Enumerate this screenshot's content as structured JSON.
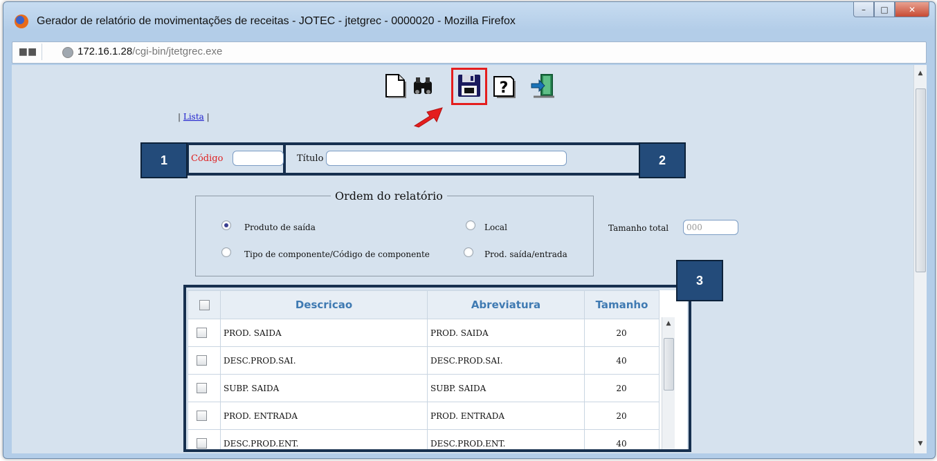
{
  "window": {
    "title": "Gerador de relatório de movimentações de receitas - JOTEC - jtetgrec - 0000020 - Mozilla Firefox",
    "url_host": "172.16.1.28",
    "url_path": "/cgi-bin/jtetgrec.exe"
  },
  "toolbar": {
    "icons": [
      "new-document-icon",
      "binoculars-search-icon",
      "floppy-save-icon",
      "help-icon",
      "exit-door-icon"
    ],
    "highlighted": "floppy-save-icon"
  },
  "nav": {
    "sep_left": "|",
    "lista": "Lista",
    "sep_right": "|"
  },
  "form": {
    "codigo_label": "Código",
    "codigo_value": "",
    "titulo_label": "Título",
    "titulo_value": "",
    "tamanho_label": "Tamanho total",
    "tamanho_placeholder": "000"
  },
  "ordem": {
    "legend": "Ordem do relatório",
    "options": [
      {
        "label": "Produto de saída",
        "selected": true
      },
      {
        "label": "Local",
        "selected": false
      },
      {
        "label": "Tipo de componente/Código de componente",
        "selected": false
      },
      {
        "label": "Prod. saída/entrada",
        "selected": false
      }
    ]
  },
  "grid": {
    "headers": [
      "Descricao",
      "Abreviatura",
      "Tamanho"
    ],
    "rows": [
      {
        "descricao": "PROD. SAIDA",
        "abreviatura": "PROD. SAIDA",
        "tamanho": "20"
      },
      {
        "descricao": "DESC.PROD.SAI.",
        "abreviatura": "DESC.PROD.SAI.",
        "tamanho": "40"
      },
      {
        "descricao": "SUBP. SAIDA",
        "abreviatura": "SUBP. SAIDA",
        "tamanho": "20"
      },
      {
        "descricao": "PROD. ENTRADA",
        "abreviatura": "PROD. ENTRADA",
        "tamanho": "20"
      },
      {
        "descricao": "DESC.PROD.ENT.",
        "abreviatura": "DESC.PROD.ENT.",
        "tamanho": "40"
      }
    ]
  },
  "callouts": {
    "one": "1",
    "two": "2",
    "three": "3"
  },
  "colors": {
    "highlight": "#e41e1e",
    "callout": "#234b7a",
    "frame": "#17304f",
    "required_label": "#e02020",
    "header_text": "#3f7ab2"
  }
}
